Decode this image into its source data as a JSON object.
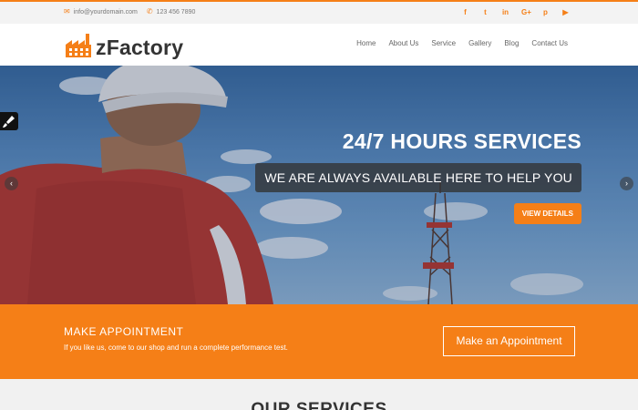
{
  "topbar": {
    "email": "info@yourdomain.com",
    "phone": "123 456 7890",
    "social": [
      {
        "icon": "facebook-icon",
        "glyph": "f"
      },
      {
        "icon": "twitter-icon",
        "glyph": "t"
      },
      {
        "icon": "linkedin-icon",
        "glyph": "in"
      },
      {
        "icon": "google-plus-icon",
        "glyph": "G+"
      },
      {
        "icon": "pinterest-icon",
        "glyph": "p"
      },
      {
        "icon": "youtube-icon",
        "glyph": "▶"
      }
    ]
  },
  "header": {
    "logo_text": "zFactory",
    "nav": [
      "Home",
      "About Us",
      "Service",
      "Gallery",
      "Blog",
      "Contact Us"
    ]
  },
  "hero": {
    "title": "24/7 HOURS SERVICES",
    "subtitle": "WE ARE ALWAYS AVAILABLE HERE TO HELP YOU",
    "button": "VIEW DETAILS"
  },
  "appointment": {
    "title": "MAKE APPOINTMENT",
    "text": "If you like us, come to our shop and run a complete performance test.",
    "button": "Make an Appointment"
  },
  "services": {
    "title": "OUR SERVICES"
  },
  "colors": {
    "accent": "#f57f17",
    "text_dark": "#333333"
  }
}
